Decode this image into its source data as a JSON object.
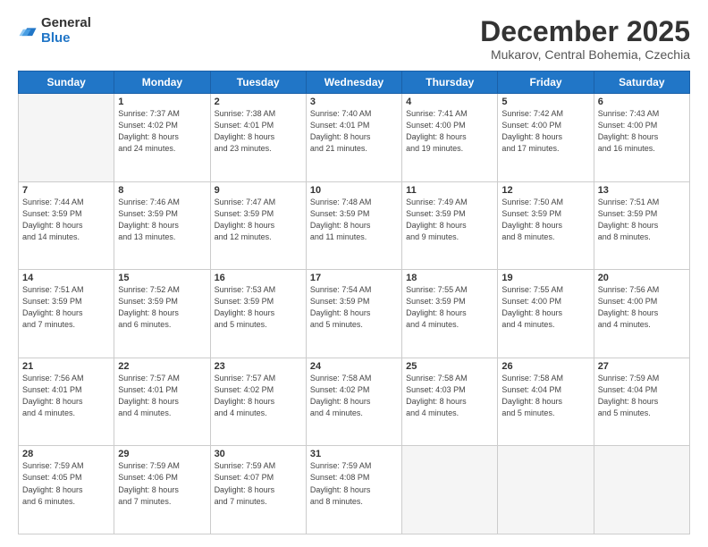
{
  "logo": {
    "general": "General",
    "blue": "Blue"
  },
  "header": {
    "month": "December 2025",
    "location": "Mukarov, Central Bohemia, Czechia"
  },
  "days_of_week": [
    "Sunday",
    "Monday",
    "Tuesday",
    "Wednesday",
    "Thursday",
    "Friday",
    "Saturday"
  ],
  "weeks": [
    [
      {
        "day": "",
        "info": ""
      },
      {
        "day": "1",
        "info": "Sunrise: 7:37 AM\nSunset: 4:02 PM\nDaylight: 8 hours\nand 24 minutes."
      },
      {
        "day": "2",
        "info": "Sunrise: 7:38 AM\nSunset: 4:01 PM\nDaylight: 8 hours\nand 23 minutes."
      },
      {
        "day": "3",
        "info": "Sunrise: 7:40 AM\nSunset: 4:01 PM\nDaylight: 8 hours\nand 21 minutes."
      },
      {
        "day": "4",
        "info": "Sunrise: 7:41 AM\nSunset: 4:00 PM\nDaylight: 8 hours\nand 19 minutes."
      },
      {
        "day": "5",
        "info": "Sunrise: 7:42 AM\nSunset: 4:00 PM\nDaylight: 8 hours\nand 17 minutes."
      },
      {
        "day": "6",
        "info": "Sunrise: 7:43 AM\nSunset: 4:00 PM\nDaylight: 8 hours\nand 16 minutes."
      }
    ],
    [
      {
        "day": "7",
        "info": "Sunrise: 7:44 AM\nSunset: 3:59 PM\nDaylight: 8 hours\nand 14 minutes."
      },
      {
        "day": "8",
        "info": "Sunrise: 7:46 AM\nSunset: 3:59 PM\nDaylight: 8 hours\nand 13 minutes."
      },
      {
        "day": "9",
        "info": "Sunrise: 7:47 AM\nSunset: 3:59 PM\nDaylight: 8 hours\nand 12 minutes."
      },
      {
        "day": "10",
        "info": "Sunrise: 7:48 AM\nSunset: 3:59 PM\nDaylight: 8 hours\nand 11 minutes."
      },
      {
        "day": "11",
        "info": "Sunrise: 7:49 AM\nSunset: 3:59 PM\nDaylight: 8 hours\nand 9 minutes."
      },
      {
        "day": "12",
        "info": "Sunrise: 7:50 AM\nSunset: 3:59 PM\nDaylight: 8 hours\nand 8 minutes."
      },
      {
        "day": "13",
        "info": "Sunrise: 7:51 AM\nSunset: 3:59 PM\nDaylight: 8 hours\nand 8 minutes."
      }
    ],
    [
      {
        "day": "14",
        "info": "Sunrise: 7:51 AM\nSunset: 3:59 PM\nDaylight: 8 hours\nand 7 minutes."
      },
      {
        "day": "15",
        "info": "Sunrise: 7:52 AM\nSunset: 3:59 PM\nDaylight: 8 hours\nand 6 minutes."
      },
      {
        "day": "16",
        "info": "Sunrise: 7:53 AM\nSunset: 3:59 PM\nDaylight: 8 hours\nand 5 minutes."
      },
      {
        "day": "17",
        "info": "Sunrise: 7:54 AM\nSunset: 3:59 PM\nDaylight: 8 hours\nand 5 minutes."
      },
      {
        "day": "18",
        "info": "Sunrise: 7:55 AM\nSunset: 3:59 PM\nDaylight: 8 hours\nand 4 minutes."
      },
      {
        "day": "19",
        "info": "Sunrise: 7:55 AM\nSunset: 4:00 PM\nDaylight: 8 hours\nand 4 minutes."
      },
      {
        "day": "20",
        "info": "Sunrise: 7:56 AM\nSunset: 4:00 PM\nDaylight: 8 hours\nand 4 minutes."
      }
    ],
    [
      {
        "day": "21",
        "info": "Sunrise: 7:56 AM\nSunset: 4:01 PM\nDaylight: 8 hours\nand 4 minutes."
      },
      {
        "day": "22",
        "info": "Sunrise: 7:57 AM\nSunset: 4:01 PM\nDaylight: 8 hours\nand 4 minutes."
      },
      {
        "day": "23",
        "info": "Sunrise: 7:57 AM\nSunset: 4:02 PM\nDaylight: 8 hours\nand 4 minutes."
      },
      {
        "day": "24",
        "info": "Sunrise: 7:58 AM\nSunset: 4:02 PM\nDaylight: 8 hours\nand 4 minutes."
      },
      {
        "day": "25",
        "info": "Sunrise: 7:58 AM\nSunset: 4:03 PM\nDaylight: 8 hours\nand 4 minutes."
      },
      {
        "day": "26",
        "info": "Sunrise: 7:58 AM\nSunset: 4:04 PM\nDaylight: 8 hours\nand 5 minutes."
      },
      {
        "day": "27",
        "info": "Sunrise: 7:59 AM\nSunset: 4:04 PM\nDaylight: 8 hours\nand 5 minutes."
      }
    ],
    [
      {
        "day": "28",
        "info": "Sunrise: 7:59 AM\nSunset: 4:05 PM\nDaylight: 8 hours\nand 6 minutes."
      },
      {
        "day": "29",
        "info": "Sunrise: 7:59 AM\nSunset: 4:06 PM\nDaylight: 8 hours\nand 7 minutes."
      },
      {
        "day": "30",
        "info": "Sunrise: 7:59 AM\nSunset: 4:07 PM\nDaylight: 8 hours\nand 7 minutes."
      },
      {
        "day": "31",
        "info": "Sunrise: 7:59 AM\nSunset: 4:08 PM\nDaylight: 8 hours\nand 8 minutes."
      },
      {
        "day": "",
        "info": ""
      },
      {
        "day": "",
        "info": ""
      },
      {
        "day": "",
        "info": ""
      }
    ]
  ]
}
